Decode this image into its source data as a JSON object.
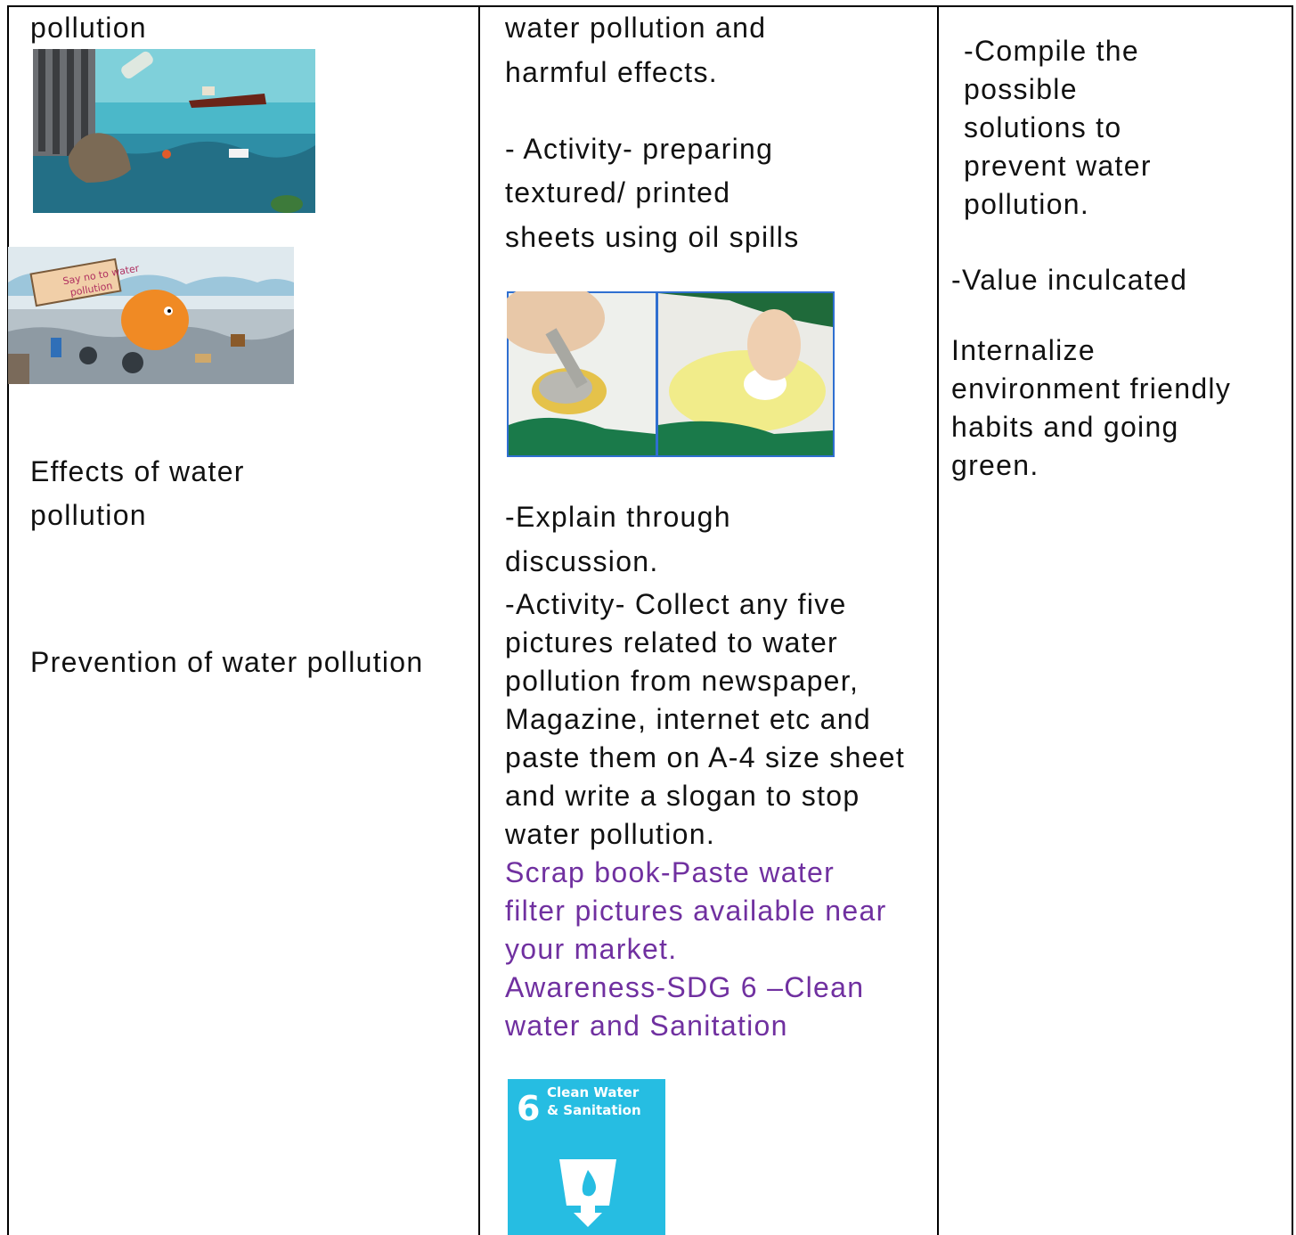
{
  "col1": {
    "pollution_heading": "pollution",
    "effects_line1": "Effects of water",
    "effects_line2": "pollution",
    "prevention": "Prevention of water pollution"
  },
  "col2": {
    "intro_line1": "water pollution and",
    "intro_line2": "harmful effects.",
    "activity1_line1": "- Activity- preparing",
    "activity1_line2": "textured/ printed",
    "activity1_line3": "sheets using oil spills",
    "explain_line1": "-Explain through",
    "explain_line2": "discussion.",
    "activity2": [
      "-Activity- Collect any five",
      "pictures related to water",
      "pollution from newspaper,",
      " Magazine, internet etc and",
      "paste them on A-4 size sheet",
      "and write a slogan to stop",
      "water pollution."
    ],
    "scrapbook": [
      " Scrap book-Paste water",
      "filter pictures available near",
      "your market."
    ],
    "awareness": [
      "Awareness-SDG 6 –Clean",
      "water and Sanitation"
    ],
    "sdg_icon": {
      "number": "6",
      "title_line1": "Clean Water",
      "title_line2": "& Sanitation"
    }
  },
  "col3": {
    "compile": [
      "-Compile the",
      "possible",
      "solutions to",
      "prevent water",
      "pollution."
    ],
    "value_heading": "-Value inculcated",
    "value_text": [
      "Internalize",
      "environment friendly",
      "habits and going",
      "green."
    ]
  },
  "drawing_sign": {
    "line1": "Say no to water",
    "line2": "pollution"
  },
  "colors": {
    "text": "#111111",
    "accent_purple": "#7030a0",
    "sdg_blue": "#26bde2",
    "border": "#000000"
  }
}
